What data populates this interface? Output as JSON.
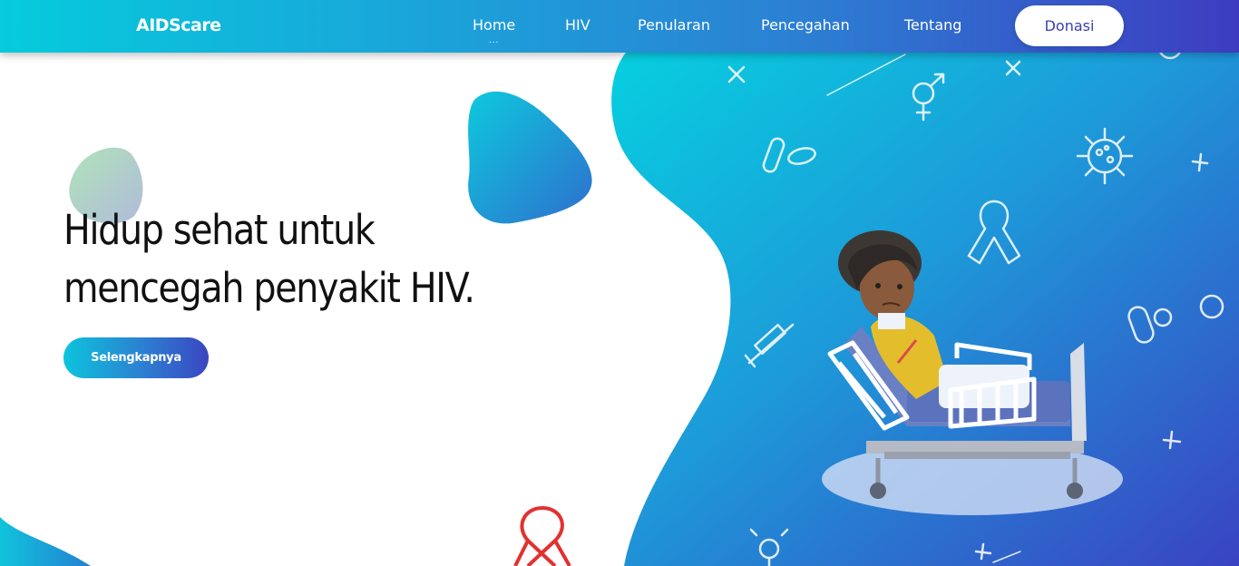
{
  "nav": {
    "brand": "AIDScare",
    "links": [
      "Home",
      "HIV",
      "Penularan",
      "Pencegahan",
      "Tentang"
    ],
    "active_indicator": "...",
    "donate_label": "Donasi"
  },
  "hero": {
    "title_line1": "Hidup sehat untuk",
    "title_line2": "mencegah penyakit HIV.",
    "cta_label": "Selengkapnya"
  },
  "colors": {
    "gradient_start": "#06cbdc",
    "gradient_end": "#3d3cc1",
    "accent_text": "#3b3fb6",
    "ribbon_red": "#e2312f"
  },
  "icons": [
    "cross-icon",
    "gender-symbol-icon",
    "virus-icon",
    "pill-icon",
    "ribbon-icon",
    "syringe-icon",
    "capsule-icon",
    "circle-icon",
    "transgender-symbol-icon",
    "plus-icon"
  ]
}
